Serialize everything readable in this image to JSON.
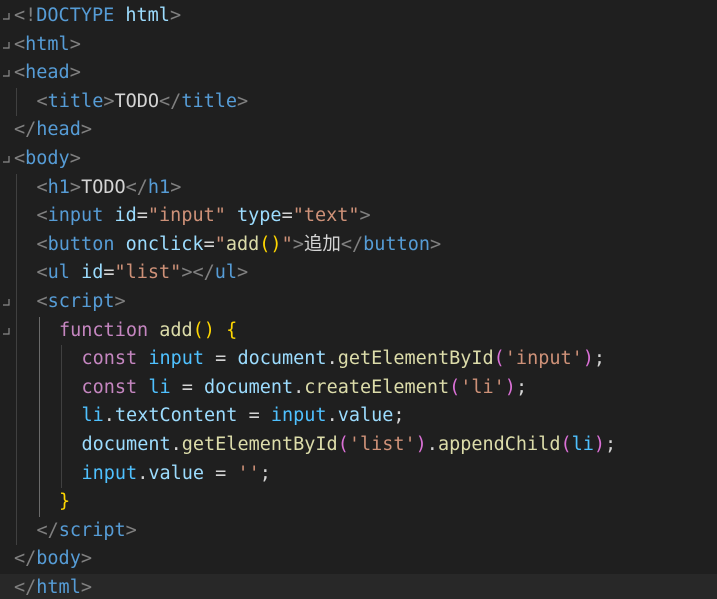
{
  "editor": {
    "theme": "dark",
    "colors": {
      "background": "#1f1f1f",
      "current_line": "#282828",
      "tag_bracket": "#808080",
      "tag_name": "#569cd6",
      "attribute": "#9cdcfe",
      "string": "#ce9178",
      "keyword": "#c586c0",
      "function": "#dcdcaa",
      "variable": "#9cdcfe",
      "object": "#4fc1ff",
      "bracket_level_1": "#ffd700",
      "bracket_level_2": "#da70d6",
      "bracket_level_3": "#179fff"
    },
    "current_line_index": 20,
    "lines": [
      {
        "fold": true,
        "indent": 0,
        "tokens": [
          [
            "br",
            "<!"
          ],
          [
            "tag",
            "DOCTYPE"
          ],
          [
            "text",
            " "
          ],
          [
            "attr",
            "html"
          ],
          [
            "br",
            ">"
          ]
        ]
      },
      {
        "fold": true,
        "indent": 0,
        "tokens": [
          [
            "br",
            "<"
          ],
          [
            "tag",
            "html"
          ],
          [
            "br",
            ">"
          ]
        ]
      },
      {
        "fold": true,
        "indent": 0,
        "tokens": [
          [
            "br",
            "<"
          ],
          [
            "tag",
            "head"
          ],
          [
            "br",
            ">"
          ]
        ]
      },
      {
        "fold": false,
        "indent": 1,
        "tokens": [
          [
            "br",
            "<"
          ],
          [
            "tag",
            "title"
          ],
          [
            "br",
            ">"
          ],
          [
            "text",
            "TODO"
          ],
          [
            "br",
            "</"
          ],
          [
            "tag",
            "title"
          ],
          [
            "br",
            ">"
          ]
        ]
      },
      {
        "fold": false,
        "indent": 0,
        "tokens": [
          [
            "br",
            "</"
          ],
          [
            "tag",
            "head"
          ],
          [
            "br",
            ">"
          ]
        ]
      },
      {
        "fold": true,
        "indent": 0,
        "tokens": [
          [
            "br",
            "<"
          ],
          [
            "tag",
            "body"
          ],
          [
            "br",
            ">"
          ]
        ]
      },
      {
        "fold": false,
        "indent": 1,
        "tokens": [
          [
            "br",
            "<"
          ],
          [
            "tag",
            "h1"
          ],
          [
            "br",
            ">"
          ],
          [
            "text",
            "TODO"
          ],
          [
            "br",
            "</"
          ],
          [
            "tag",
            "h1"
          ],
          [
            "br",
            ">"
          ]
        ]
      },
      {
        "fold": false,
        "indent": 1,
        "tokens": [
          [
            "br",
            "<"
          ],
          [
            "tag",
            "input"
          ],
          [
            "text",
            " "
          ],
          [
            "attr",
            "id"
          ],
          [
            "text",
            "="
          ],
          [
            "str",
            "\"input\""
          ],
          [
            "text",
            " "
          ],
          [
            "attr",
            "type"
          ],
          [
            "text",
            "="
          ],
          [
            "str",
            "\"text\""
          ],
          [
            "br",
            ">"
          ]
        ]
      },
      {
        "fold": false,
        "indent": 1,
        "tokens": [
          [
            "br",
            "<"
          ],
          [
            "tag",
            "button"
          ],
          [
            "text",
            " "
          ],
          [
            "attr",
            "onclick"
          ],
          [
            "text",
            "="
          ],
          [
            "str",
            "\""
          ],
          [
            "fn",
            "add"
          ],
          [
            "b1",
            "()"
          ],
          [
            "str",
            "\""
          ],
          [
            "br",
            ">"
          ],
          [
            "text",
            "追加"
          ],
          [
            "br",
            "</"
          ],
          [
            "tag",
            "button"
          ],
          [
            "br",
            ">"
          ]
        ]
      },
      {
        "fold": false,
        "indent": 1,
        "tokens": [
          [
            "br",
            "<"
          ],
          [
            "tag",
            "ul"
          ],
          [
            "text",
            " "
          ],
          [
            "attr",
            "id"
          ],
          [
            "text",
            "="
          ],
          [
            "str",
            "\"list\""
          ],
          [
            "br",
            "></"
          ],
          [
            "tag",
            "ul"
          ],
          [
            "br",
            ">"
          ]
        ]
      },
      {
        "fold": true,
        "indent": 1,
        "tokens": [
          [
            "br",
            "<"
          ],
          [
            "tag",
            "script"
          ],
          [
            "br",
            ">"
          ]
        ]
      },
      {
        "fold": true,
        "indent": 2,
        "tokens": [
          [
            "kw",
            "function"
          ],
          [
            "text",
            " "
          ],
          [
            "fn",
            "add"
          ],
          [
            "b1",
            "()"
          ],
          [
            "text",
            " "
          ],
          [
            "b1",
            "{"
          ]
        ]
      },
      {
        "fold": false,
        "indent": 3,
        "tokens": [
          [
            "kw",
            "const"
          ],
          [
            "text",
            " "
          ],
          [
            "obj",
            "input"
          ],
          [
            "text",
            " = "
          ],
          [
            "var",
            "document"
          ],
          [
            "punc",
            "."
          ],
          [
            "fn",
            "getElementById"
          ],
          [
            "b2",
            "("
          ],
          [
            "str",
            "'input'"
          ],
          [
            "b2",
            ")"
          ],
          [
            "punc",
            ";"
          ]
        ]
      },
      {
        "fold": false,
        "indent": 3,
        "tokens": [
          [
            "kw",
            "const"
          ],
          [
            "text",
            " "
          ],
          [
            "obj",
            "li"
          ],
          [
            "text",
            " = "
          ],
          [
            "var",
            "document"
          ],
          [
            "punc",
            "."
          ],
          [
            "fn",
            "createElement"
          ],
          [
            "b2",
            "("
          ],
          [
            "str",
            "'li'"
          ],
          [
            "b2",
            ")"
          ],
          [
            "punc",
            ";"
          ]
        ]
      },
      {
        "fold": false,
        "indent": 3,
        "tokens": [
          [
            "obj",
            "li"
          ],
          [
            "punc",
            "."
          ],
          [
            "var",
            "textContent"
          ],
          [
            "text",
            " = "
          ],
          [
            "obj",
            "input"
          ],
          [
            "punc",
            "."
          ],
          [
            "var",
            "value"
          ],
          [
            "punc",
            ";"
          ]
        ]
      },
      {
        "fold": false,
        "indent": 3,
        "tokens": [
          [
            "var",
            "document"
          ],
          [
            "punc",
            "."
          ],
          [
            "fn",
            "getElementById"
          ],
          [
            "b2",
            "("
          ],
          [
            "str",
            "'list'"
          ],
          [
            "b2",
            ")"
          ],
          [
            "punc",
            "."
          ],
          [
            "fn",
            "appendChild"
          ],
          [
            "b2",
            "("
          ],
          [
            "obj",
            "li"
          ],
          [
            "b2",
            ")"
          ],
          [
            "punc",
            ";"
          ]
        ]
      },
      {
        "fold": false,
        "indent": 3,
        "tokens": [
          [
            "obj",
            "input"
          ],
          [
            "punc",
            "."
          ],
          [
            "var",
            "value"
          ],
          [
            "text",
            " = "
          ],
          [
            "str",
            "''"
          ],
          [
            "punc",
            ";"
          ]
        ]
      },
      {
        "fold": false,
        "indent": 2,
        "tokens": [
          [
            "b1",
            "}"
          ]
        ]
      },
      {
        "fold": false,
        "indent": 1,
        "tokens": [
          [
            "br",
            "</"
          ],
          [
            "tag",
            "script"
          ],
          [
            "br",
            ">"
          ]
        ]
      },
      {
        "fold": false,
        "indent": 0,
        "tokens": [
          [
            "br",
            "</"
          ],
          [
            "tag",
            "body"
          ],
          [
            "br",
            ">"
          ]
        ]
      },
      {
        "fold": false,
        "indent": 0,
        "tokens": [
          [
            "br",
            "</"
          ],
          [
            "tag",
            "html"
          ],
          [
            "br",
            ">"
          ]
        ]
      }
    ]
  }
}
